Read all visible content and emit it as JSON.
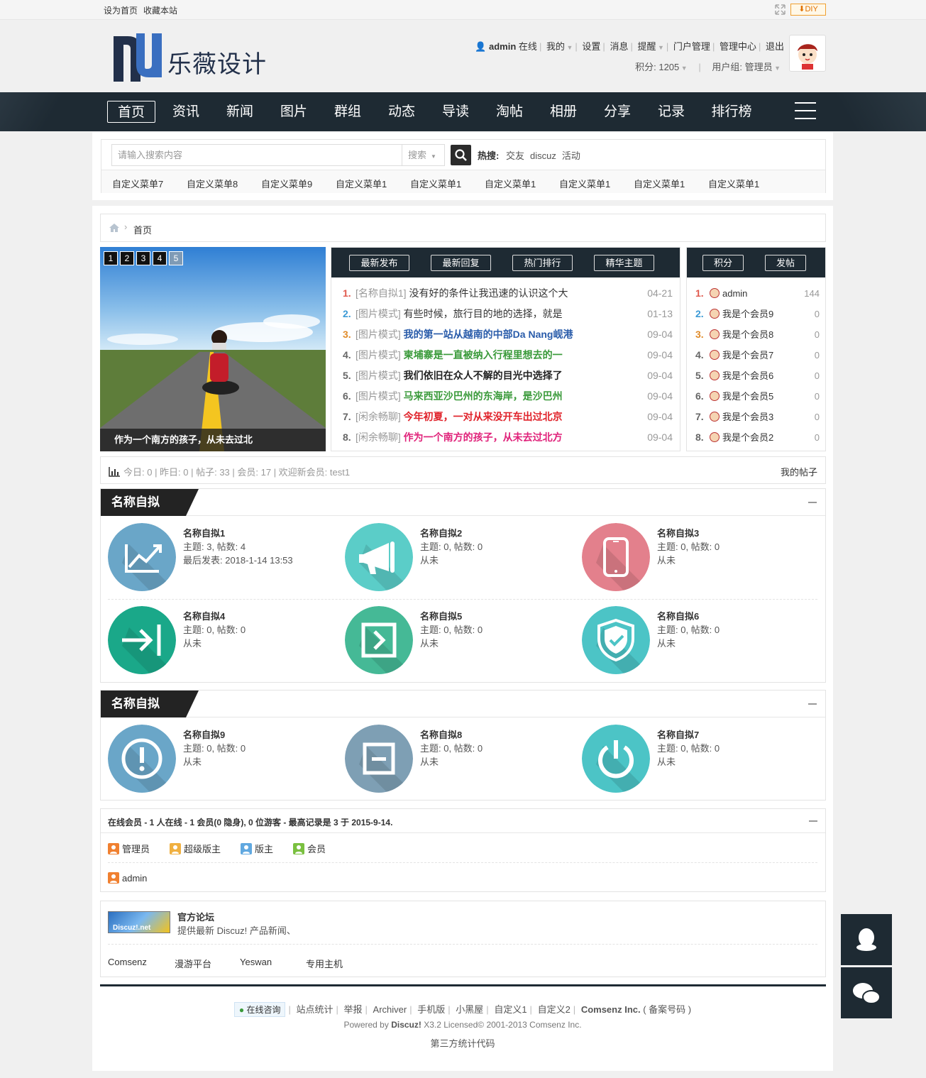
{
  "topbar": {
    "set_home": "设为首页",
    "bookmark": "收藏本站",
    "diy": "DIY"
  },
  "header": {
    "logo_text": "乐薇设计",
    "username": "admin",
    "online": "在线",
    "menu": [
      "我的",
      "设置",
      "消息",
      "提醒",
      "门户管理",
      "管理中心",
      "退出"
    ],
    "points": "积分: 1205",
    "usergroup": "用户组: 管理员"
  },
  "nav": {
    "items": [
      "首页",
      "资讯",
      "新闻",
      "图片",
      "群组",
      "动态",
      "导读",
      "淘帖",
      "相册",
      "分享",
      "记录",
      "排行榜"
    ]
  },
  "search": {
    "placeholder": "请输入搜索内容",
    "select": "搜索",
    "hot_label": "热搜:",
    "hot": [
      "交友",
      "discuz",
      "活动"
    ]
  },
  "custom_menu": [
    "自定义菜单7",
    "自定义菜单8",
    "自定义菜单9",
    "自定义菜单1",
    "自定义菜单1",
    "自定义菜单1",
    "自定义菜单1",
    "自定义菜单1",
    "自定义菜单1"
  ],
  "breadcrumb": {
    "current": "首页"
  },
  "slider": {
    "buttons": [
      "1",
      "2",
      "3",
      "4",
      "5"
    ],
    "caption": "作为一个南方的孩子，从未去过北"
  },
  "posts": {
    "tabs": [
      "最新发布",
      "最新回复",
      "热门排行",
      "精华主题"
    ],
    "items": [
      {
        "num": "1.",
        "cat": "[名称自拟1]",
        "title": "没有好的条件让我迅速的认识这个大",
        "date": "04-21",
        "color": "#333333",
        "numcolor": "#e05a4e"
      },
      {
        "num": "2.",
        "cat": "[图片模式]",
        "title": "有些时候，旅行目的地的选择，就是",
        "date": "01-13",
        "color": "#333333",
        "numcolor": "#3c9ad6"
      },
      {
        "num": "3.",
        "cat": "[图片模式]",
        "title": "我的第一站从越南的中部Da Nang岘港",
        "date": "09-04",
        "color": "#2a5caa",
        "numcolor": "#e08b2a"
      },
      {
        "num": "4.",
        "cat": "[图片模式]",
        "title": "柬埔寨是一直被纳入行程里想去的一",
        "date": "09-04",
        "color": "#3a9a3a",
        "numcolor": "#666666"
      },
      {
        "num": "5.",
        "cat": "[图片模式]",
        "title": "我们依旧在众人不解的目光中选择了",
        "date": "09-04",
        "color": "#222222",
        "numcolor": "#666666"
      },
      {
        "num": "6.",
        "cat": "[图片模式]",
        "title": "马来西亚沙巴州的东海岸，是沙巴州",
        "date": "09-04",
        "color": "#3a9a3a",
        "numcolor": "#666666"
      },
      {
        "num": "7.",
        "cat": "[闲余畅聊]",
        "title": "今年初夏，一对从来没开车出过北京",
        "date": "09-04",
        "color": "#e0222a",
        "numcolor": "#666666"
      },
      {
        "num": "8.",
        "cat": "[闲余畅聊]",
        "title": "作为一个南方的孩子，从未去过北方",
        "date": "09-04",
        "color": "#e0227a",
        "numcolor": "#666666"
      }
    ]
  },
  "ranking": {
    "tabs": [
      "积分",
      "发帖"
    ],
    "items": [
      {
        "num": "1.",
        "name": "admin",
        "value": "144",
        "numcolor": "#e05a4e"
      },
      {
        "num": "2.",
        "name": "我是个会员9",
        "value": "0",
        "numcolor": "#3c9ad6"
      },
      {
        "num": "3.",
        "name": "我是个会员8",
        "value": "0",
        "numcolor": "#e08b2a"
      },
      {
        "num": "4.",
        "name": "我是个会员7",
        "value": "0",
        "numcolor": "#666666"
      },
      {
        "num": "5.",
        "name": "我是个会员6",
        "value": "0",
        "numcolor": "#666666"
      },
      {
        "num": "6.",
        "name": "我是个会员5",
        "value": "0",
        "numcolor": "#666666"
      },
      {
        "num": "7.",
        "name": "我是个会员3",
        "value": "0",
        "numcolor": "#666666"
      },
      {
        "num": "8.",
        "name": "我是个会员2",
        "value": "0",
        "numcolor": "#666666"
      }
    ]
  },
  "stats": {
    "text": "今日: 0 | 昨日: 0 | 帖子: 33 | 会员: 17 | 欢迎新会员: test1",
    "my_posts": "我的帖子"
  },
  "forum_groups": [
    {
      "title": "名称自拟",
      "forums": [
        {
          "name": "名称自拟1",
          "stats": "主题: 3, 帖数: 4",
          "last": "最后发表: 2018-1-14 13:53",
          "icon": "chart-icon",
          "color": "#6aa6c8"
        },
        {
          "name": "名称自拟2",
          "stats": "主题: 0, 帖数: 0",
          "last": "从未",
          "icon": "megaphone-icon",
          "color": "#5bcdc8"
        },
        {
          "name": "名称自拟3",
          "stats": "主题: 0, 帖数: 0",
          "last": "从未",
          "icon": "phone-icon",
          "color": "#e3808c"
        },
        {
          "name": "名称自拟4",
          "stats": "主题: 0, 帖数: 0",
          "last": "从未",
          "icon": "arrow-right-bar-icon",
          "color": "#1aa889"
        },
        {
          "name": "名称自拟5",
          "stats": "主题: 0, 帖数: 0",
          "last": "从未",
          "icon": "next-box-icon",
          "color": "#45b996"
        },
        {
          "name": "名称自拟6",
          "stats": "主题: 0, 帖数: 0",
          "last": "从未",
          "icon": "shield-check-icon",
          "color": "#4cc4c6"
        }
      ]
    },
    {
      "title": "名称自拟",
      "forums": [
        {
          "name": "名称自拟9",
          "stats": "主题: 0, 帖数: 0",
          "last": "从未",
          "icon": "exclamation-icon",
          "color": "#6aa6c8"
        },
        {
          "name": "名称自拟8",
          "stats": "主题: 0, 帖数: 0",
          "last": "从未",
          "icon": "minus-box-icon",
          "color": "#7e9fb4"
        },
        {
          "name": "名称自拟7",
          "stats": "主题: 0, 帖数: 0",
          "last": "从未",
          "icon": "power-icon",
          "color": "#4cc4c6"
        }
      ]
    }
  ],
  "online": {
    "header": "在线会员 - 1 人在线 - 1 会员(0 隐身), 0 位游客 - 最高记录是 3 于 2015-9-14.",
    "groups": [
      {
        "label": "管理员",
        "color": "#f08030"
      },
      {
        "label": "超级版主",
        "color": "#f0b040"
      },
      {
        "label": "版主",
        "color": "#60a8e0"
      },
      {
        "label": "会员",
        "color": "#7ac040"
      }
    ],
    "users": [
      "admin"
    ]
  },
  "links": {
    "logo_text": "Discuz!.net",
    "title": "官方论坛",
    "desc": "提供最新 Discuz! 产品新闻、",
    "items": [
      "Comsenz",
      "漫游平台",
      "Yeswan",
      "专用主机"
    ]
  },
  "footer": {
    "consult": "在线咨询",
    "links": [
      "站点统计",
      "举报",
      "Archiver",
      "手机版",
      "小黑屋",
      "自定义1",
      "自定义2"
    ],
    "company": "Comsenz Inc.",
    "icp": "( 备案号码 )",
    "powered_prefix": "Powered by",
    "powered_brand": "Discuz!",
    "powered_suffix": "X3.2 Licensed© 2001-2013 Comsenz Inc.",
    "stats_code": "第三方统计代码"
  }
}
